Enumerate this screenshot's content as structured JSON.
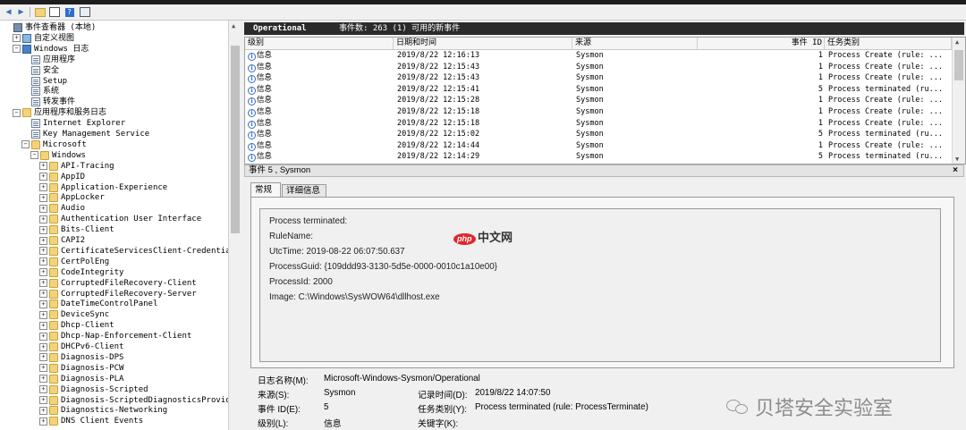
{
  "toolbar": {
    "buttons": [
      "back-arrow-icon",
      "forward-arrow-icon",
      "folder-up-icon",
      "console-icon",
      "help-icon",
      "properties-icon"
    ]
  },
  "tree": {
    "items": [
      {
        "label": "事件查看器 (本地)",
        "depth": 0,
        "expander": "",
        "icon": "viewer"
      },
      {
        "label": "自定义视图",
        "depth": 1,
        "expander": "+",
        "icon": "custom"
      },
      {
        "label": "Windows 日志",
        "depth": 1,
        "expander": "-",
        "icon": "win"
      },
      {
        "label": "应用程序",
        "depth": 2,
        "expander": "",
        "icon": "log"
      },
      {
        "label": "安全",
        "depth": 2,
        "expander": "",
        "icon": "log"
      },
      {
        "label": "Setup",
        "depth": 2,
        "expander": "",
        "icon": "log"
      },
      {
        "label": "系统",
        "depth": 2,
        "expander": "",
        "icon": "log"
      },
      {
        "label": "转发事件",
        "depth": 2,
        "expander": "",
        "icon": "log"
      },
      {
        "label": "应用程序和服务日志",
        "depth": 1,
        "expander": "-",
        "icon": "folder"
      },
      {
        "label": "Internet Explorer",
        "depth": 2,
        "expander": "",
        "icon": "log"
      },
      {
        "label": "Key Management Service",
        "depth": 2,
        "expander": "",
        "icon": "log"
      },
      {
        "label": "Microsoft",
        "depth": 2,
        "expander": "-",
        "icon": "folder"
      },
      {
        "label": "Windows",
        "depth": 3,
        "expander": "-",
        "icon": "folder"
      },
      {
        "label": "API-Tracing",
        "depth": 4,
        "expander": "+",
        "icon": "folder"
      },
      {
        "label": "AppID",
        "depth": 4,
        "expander": "+",
        "icon": "folder"
      },
      {
        "label": "Application-Experience",
        "depth": 4,
        "expander": "+",
        "icon": "folder"
      },
      {
        "label": "AppLocker",
        "depth": 4,
        "expander": "+",
        "icon": "folder"
      },
      {
        "label": "Audio",
        "depth": 4,
        "expander": "+",
        "icon": "folder"
      },
      {
        "label": "Authentication User Interface",
        "depth": 4,
        "expander": "+",
        "icon": "folder"
      },
      {
        "label": "Bits-Client",
        "depth": 4,
        "expander": "+",
        "icon": "folder"
      },
      {
        "label": "CAPI2",
        "depth": 4,
        "expander": "+",
        "icon": "folder"
      },
      {
        "label": "CertificateServicesClient-Credential",
        "depth": 4,
        "expander": "+",
        "icon": "folder"
      },
      {
        "label": "CertPolEng",
        "depth": 4,
        "expander": "+",
        "icon": "folder"
      },
      {
        "label": "CodeIntegrity",
        "depth": 4,
        "expander": "+",
        "icon": "folder"
      },
      {
        "label": "CorruptedFileRecovery-Client",
        "depth": 4,
        "expander": "+",
        "icon": "folder"
      },
      {
        "label": "CorruptedFileRecovery-Server",
        "depth": 4,
        "expander": "+",
        "icon": "folder"
      },
      {
        "label": "DateTimeControlPanel",
        "depth": 4,
        "expander": "+",
        "icon": "folder"
      },
      {
        "label": "DeviceSync",
        "depth": 4,
        "expander": "+",
        "icon": "folder"
      },
      {
        "label": "Dhcp-Client",
        "depth": 4,
        "expander": "+",
        "icon": "folder"
      },
      {
        "label": "Dhcp-Nap-Enforcement-Client",
        "depth": 4,
        "expander": "+",
        "icon": "folder"
      },
      {
        "label": "DHCPv6-Client",
        "depth": 4,
        "expander": "+",
        "icon": "folder"
      },
      {
        "label": "Diagnosis-DPS",
        "depth": 4,
        "expander": "+",
        "icon": "folder"
      },
      {
        "label": "Diagnosis-PCW",
        "depth": 4,
        "expander": "+",
        "icon": "folder"
      },
      {
        "label": "Diagnosis-PLA",
        "depth": 4,
        "expander": "+",
        "icon": "folder"
      },
      {
        "label": "Diagnosis-Scripted",
        "depth": 4,
        "expander": "+",
        "icon": "folder"
      },
      {
        "label": "Diagnosis-ScriptedDiagnosticsProvide",
        "depth": 4,
        "expander": "+",
        "icon": "folder"
      },
      {
        "label": "Diagnostics-Networking",
        "depth": 4,
        "expander": "+",
        "icon": "folder"
      },
      {
        "label": "DNS Client Events",
        "depth": 4,
        "expander": "+",
        "icon": "folder"
      }
    ]
  },
  "header": {
    "title": "Operational",
    "count": "事件数: 263 (1) 可用的新事件"
  },
  "grid": {
    "columns": [
      "级别",
      "日期和时间",
      "来源",
      "事件 ID",
      "任务类别"
    ],
    "rows": [
      {
        "level": "信息",
        "time": "2019/8/22 12:16:13",
        "source": "Sysmon",
        "id": "1",
        "task": "Process Create (rule: ..."
      },
      {
        "level": "信息",
        "time": "2019/8/22 12:15:43",
        "source": "Sysmon",
        "id": "1",
        "task": "Process Create (rule: ..."
      },
      {
        "level": "信息",
        "time": "2019/8/22 12:15:43",
        "source": "Sysmon",
        "id": "1",
        "task": "Process Create (rule: ..."
      },
      {
        "level": "信息",
        "time": "2019/8/22 12:15:41",
        "source": "Sysmon",
        "id": "5",
        "task": "Process terminated (ru..."
      },
      {
        "level": "信息",
        "time": "2019/8/22 12:15:28",
        "source": "Sysmon",
        "id": "1",
        "task": "Process Create (rule: ..."
      },
      {
        "level": "信息",
        "time": "2019/8/22 12:15:18",
        "source": "Sysmon",
        "id": "1",
        "task": "Process Create (rule: ..."
      },
      {
        "level": "信息",
        "time": "2019/8/22 12:15:18",
        "source": "Sysmon",
        "id": "1",
        "task": "Process Create (rule: ..."
      },
      {
        "level": "信息",
        "time": "2019/8/22 12:15:02",
        "source": "Sysmon",
        "id": "5",
        "task": "Process terminated (ru..."
      },
      {
        "level": "信息",
        "time": "2019/8/22 12:14:44",
        "source": "Sysmon",
        "id": "1",
        "task": "Process Create (rule: ..."
      },
      {
        "level": "信息",
        "time": "2019/8/22 12:14:29",
        "source": "Sysmon",
        "id": "5",
        "task": "Process terminated (ru..."
      }
    ]
  },
  "detail": {
    "title": "事件 5 , Sysmon",
    "close": "×",
    "tabs": [
      "常规",
      "详细信息"
    ],
    "lines": [
      "Process terminated:",
      "RuleName:",
      "UtcTime: 2019-08-22 06:07:50.637",
      "ProcessGuid: {109ddd93-3130-5d5e-0000-0010c1a10e00}",
      "ProcessId: 2000",
      "Image: C:\\Windows\\SysWOW64\\dllhost.exe"
    ],
    "props": {
      "logname_label": "日志名称(M):",
      "logname": "Microsoft-Windows-Sysmon/Operational",
      "source_label": "来源(S):",
      "source": "Sysmon",
      "logged_label": "记录时间(D):",
      "logged": "2019/8/22 14:07:50",
      "eventid_label": "事件 ID(E):",
      "eventid": "5",
      "task_label": "任务类别(Y):",
      "task": "Process terminated (rule: ProcessTerminate)",
      "level_label": "级别(L):",
      "level": "信息",
      "keywords_label": "关键字(K):"
    }
  },
  "watermarks": {
    "php": "php",
    "php_cn": "中文网",
    "wechat": "贝塔安全实验室"
  },
  "colors": {
    "header_bg": "#2b2b2b",
    "info_blue": "#3a6ec0",
    "php_red": "#e0262b"
  }
}
